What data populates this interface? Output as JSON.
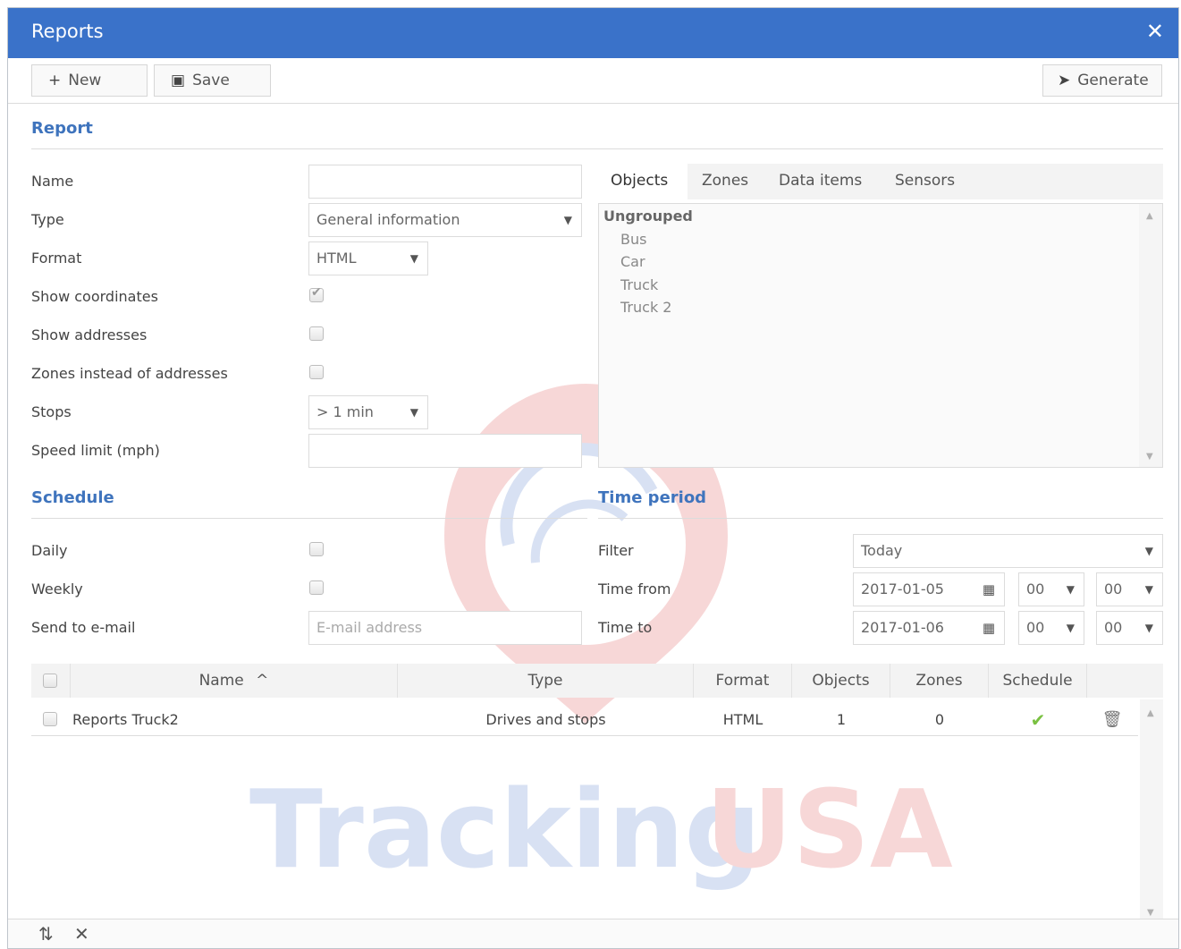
{
  "window": {
    "title": "Reports",
    "close_label": "✕"
  },
  "toolbar": {
    "new_label": "New",
    "save_label": "Save",
    "generate_label": "Generate"
  },
  "report": {
    "section_title": "Report",
    "fields": {
      "name": {
        "label": "Name",
        "value": ""
      },
      "type": {
        "label": "Type",
        "value": "General information"
      },
      "format": {
        "label": "Format",
        "value": "HTML"
      },
      "show_coordinates": {
        "label": "Show coordinates",
        "checked": true
      },
      "show_addresses": {
        "label": "Show addresses",
        "checked": false
      },
      "zones_instead": {
        "label": "Zones instead of addresses",
        "checked": false
      },
      "stops": {
        "label": "Stops",
        "value": "> 1 min"
      },
      "speed_limit": {
        "label": "Speed limit (mph)",
        "value": ""
      }
    }
  },
  "object_tabs": [
    "Objects",
    "Zones",
    "Data items",
    "Sensors"
  ],
  "object_tabs_active": "Objects",
  "objects": {
    "group": "Ungrouped",
    "items": [
      "Bus",
      "Car",
      "Truck",
      "Truck 2"
    ]
  },
  "schedule": {
    "section_title": "Schedule",
    "daily": {
      "label": "Daily",
      "checked": false
    },
    "weekly": {
      "label": "Weekly",
      "checked": false
    },
    "email": {
      "label": "Send to e-mail",
      "placeholder": "E-mail address",
      "value": ""
    }
  },
  "time_period": {
    "section_title": "Time period",
    "filter": {
      "label": "Filter",
      "value": "Today"
    },
    "time_from": {
      "label": "Time from",
      "date": "2017-01-05",
      "hour": "00",
      "minute": "00"
    },
    "time_to": {
      "label": "Time to",
      "date": "2017-01-06",
      "hour": "00",
      "minute": "00"
    }
  },
  "table": {
    "columns": [
      "Name",
      "Type",
      "Format",
      "Objects",
      "Zones",
      "Schedule"
    ],
    "sort_indicator": "^",
    "rows": [
      {
        "name": "Reports Truck2",
        "type": "Drives and stops",
        "format": "HTML",
        "objects": "1",
        "zones": "0",
        "schedule": "✔"
      }
    ]
  },
  "watermark": {
    "text_left": "Tracking",
    "text_right": "USA"
  },
  "colors": {
    "header": "#3a72c9",
    "section": "#3f74bd",
    "check_ok": "#7ac142"
  }
}
